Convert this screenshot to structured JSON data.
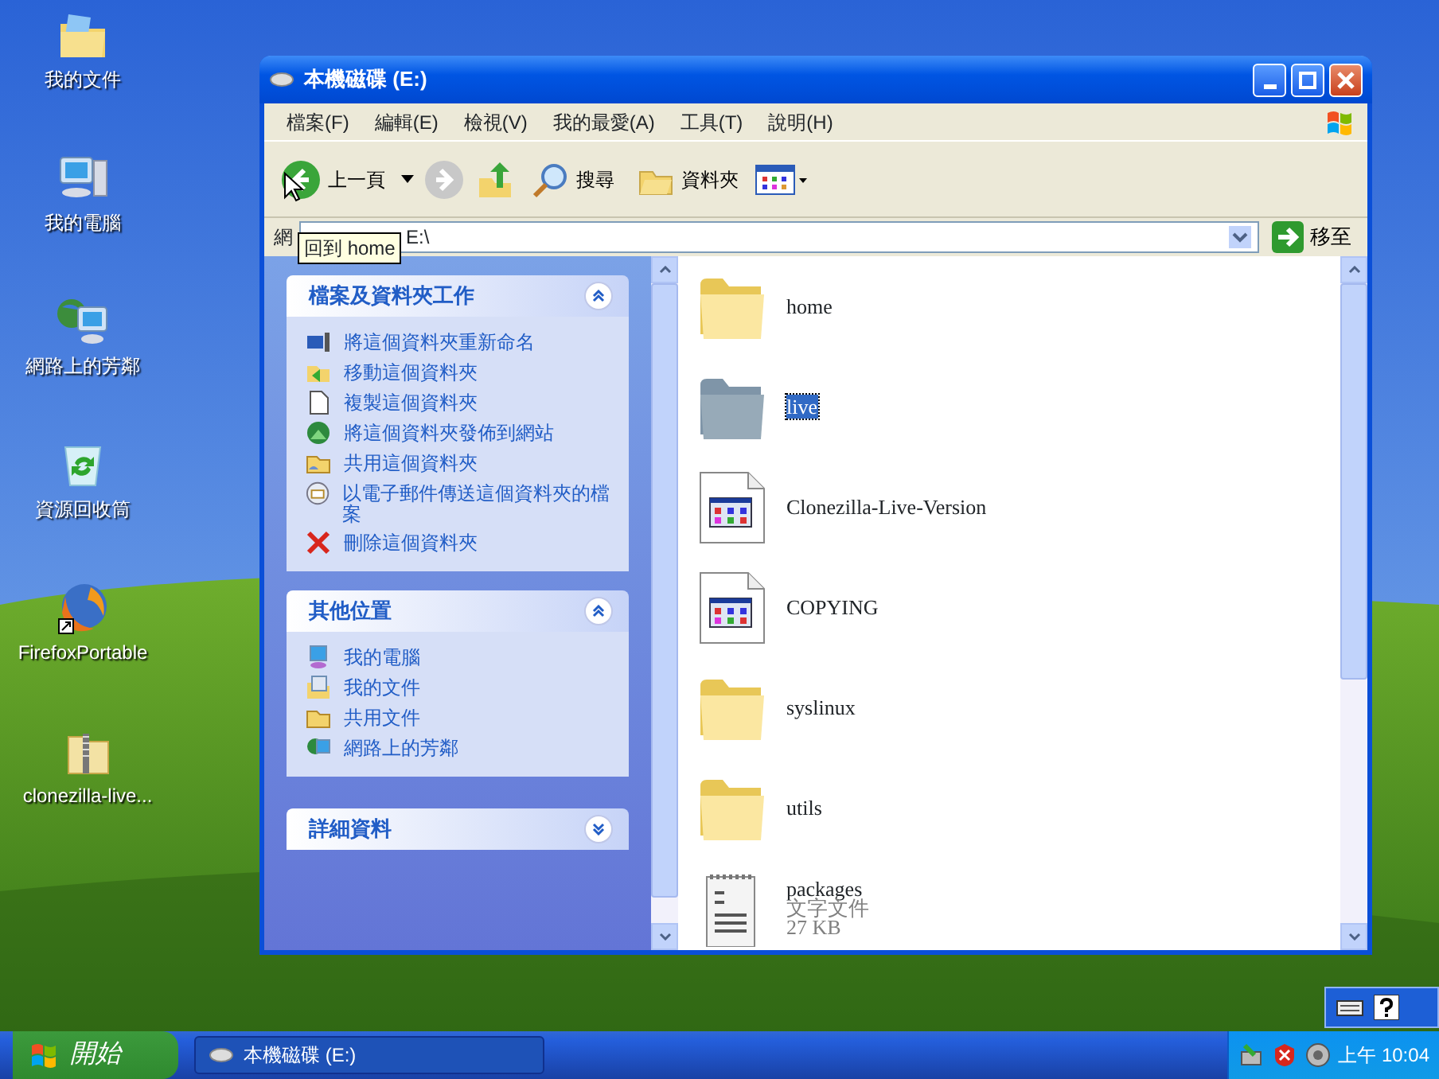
{
  "desktop_icons": [
    {
      "label": "我的文件",
      "kind": "documents"
    },
    {
      "label": "我的電腦",
      "kind": "computer"
    },
    {
      "label": "網路上的芳鄰",
      "kind": "network"
    },
    {
      "label": "資源回收筒",
      "kind": "recycle"
    },
    {
      "label": "FirefoxPortable",
      "kind": "firefox"
    },
    {
      "label": "clonezilla-live...",
      "kind": "zip"
    }
  ],
  "window": {
    "title": "本機磁碟 (E:)",
    "menu": [
      "檔案(F)",
      "編輯(E)",
      "檢視(V)",
      "我的最愛(A)",
      "工具(T)",
      "說明(H)"
    ],
    "toolbar": {
      "back": "上一頁",
      "search": "搜尋",
      "folders": "資料夾"
    },
    "address": {
      "label": "網",
      "value": "E:\\",
      "go": "移至"
    },
    "tooltip": "回到 home",
    "task_panes": [
      {
        "title": "檔案及資料夾工作",
        "expanded": true,
        "items": [
          {
            "label": "將這個資料夾重新命名",
            "kind": "rename"
          },
          {
            "label": "移動這個資料夾",
            "kind": "move"
          },
          {
            "label": "複製這個資料夾",
            "kind": "copy"
          },
          {
            "label": "將這個資料夾發佈到網站",
            "kind": "publish"
          },
          {
            "label": "共用這個資料夾",
            "kind": "share"
          },
          {
            "label": "以電子郵件傳送這個資料夾的檔案",
            "kind": "email"
          },
          {
            "label": "刪除這個資料夾",
            "kind": "delete"
          }
        ]
      },
      {
        "title": "其他位置",
        "expanded": true,
        "items": [
          {
            "label": "我的電腦",
            "kind": "computer"
          },
          {
            "label": "我的文件",
            "kind": "documents"
          },
          {
            "label": "共用文件",
            "kind": "folder"
          },
          {
            "label": "網路上的芳鄰",
            "kind": "network"
          }
        ]
      },
      {
        "title": "詳細資料",
        "expanded": false
      }
    ],
    "files": [
      {
        "name": "home",
        "kind": "folder",
        "selected": false
      },
      {
        "name": "live",
        "kind": "folder",
        "selected": true
      },
      {
        "name": "Clonezilla-Live-Version",
        "kind": "file",
        "selected": false
      },
      {
        "name": "COPYING",
        "kind": "file",
        "selected": false
      },
      {
        "name": "syslinux",
        "kind": "folder",
        "selected": false
      },
      {
        "name": "utils",
        "kind": "folder",
        "selected": false
      },
      {
        "name": "packages",
        "kind": "text",
        "selected": false,
        "details": [
          "文字文件",
          "27 KB"
        ]
      }
    ]
  },
  "taskbar": {
    "start": "開始",
    "tasks": [
      {
        "label": "本機磁碟 (E:)"
      }
    ],
    "clock": "上午 10:04"
  }
}
